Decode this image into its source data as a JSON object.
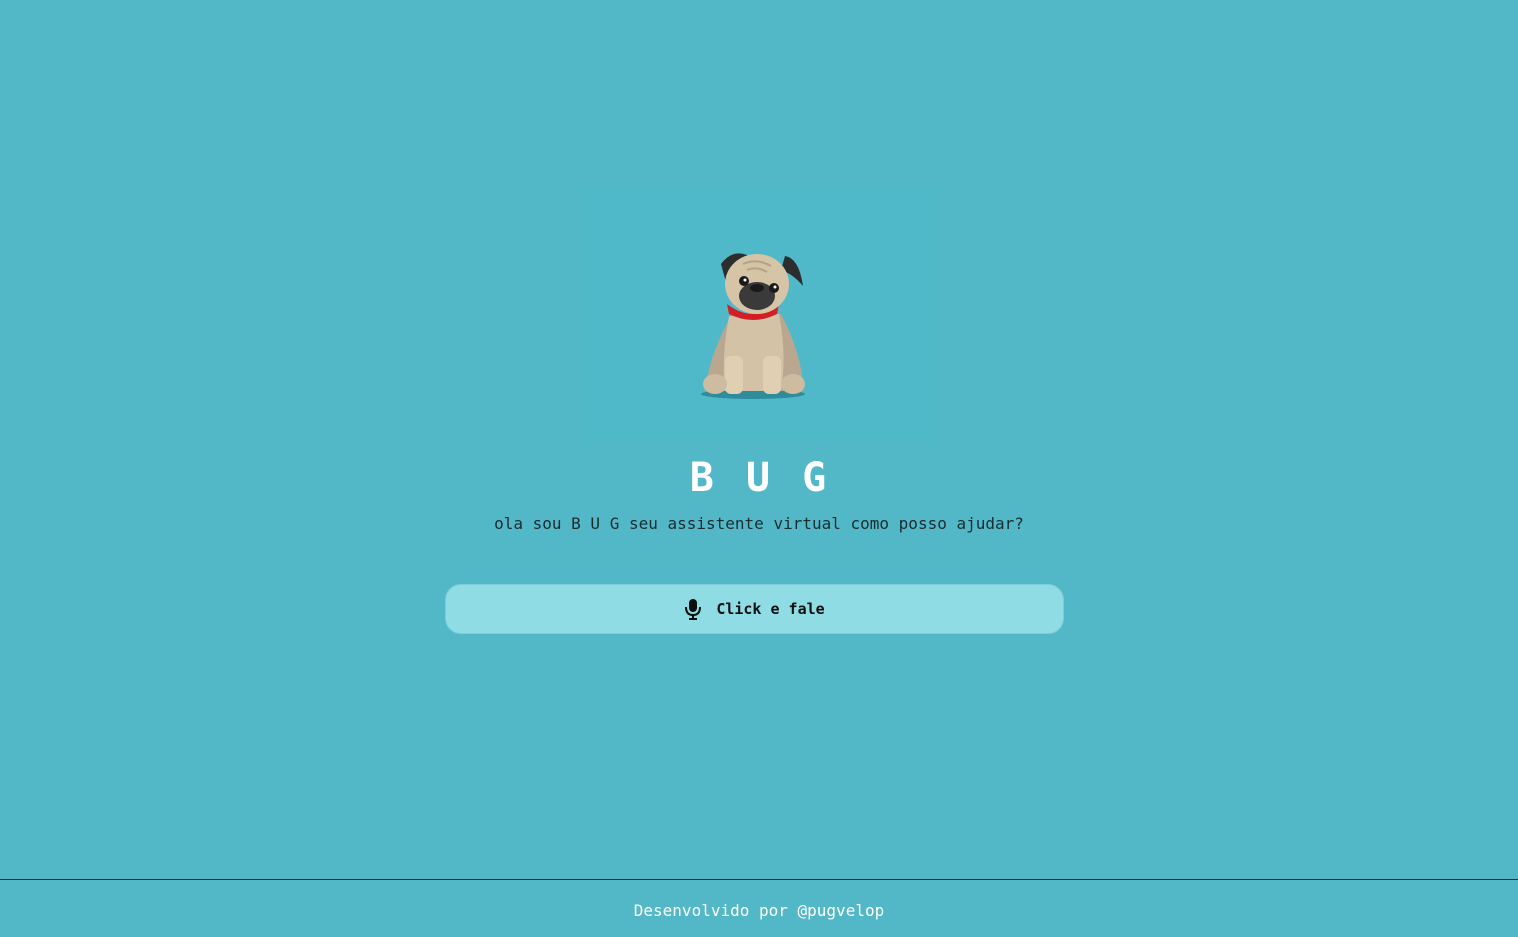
{
  "assistant": {
    "name": "B U G",
    "greeting": "ola sou B U G seu assistente virtual como posso ajudar?"
  },
  "mascot": {
    "icon": "pug-dog-icon"
  },
  "voice_button": {
    "label": "Click e fale",
    "icon": "microphone-icon"
  },
  "footer": {
    "credit": "Desenvolvido por @pugvelop"
  },
  "colors": {
    "background": "#52b8c8",
    "button": "#8fdce4",
    "collar": "#d21f26"
  }
}
